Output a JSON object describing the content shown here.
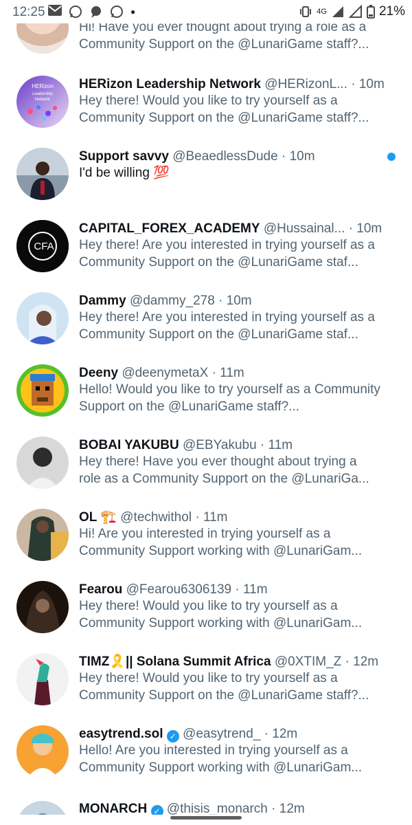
{
  "status_bar": {
    "time": "12:25",
    "network": "4G",
    "battery": "21%",
    "icons": [
      "gmail-icon",
      "whatsapp-icon",
      "chat-icon",
      "whatsapp-icon",
      "dot-icon",
      "vibrate-icon",
      "signal-icon",
      "signal-icon",
      "battery-icon"
    ]
  },
  "conversations": [
    {
      "name": "",
      "handle": "",
      "time": "",
      "preview": "Hi! Have you ever thought about trying a role as a Community Support on the @LunariGame staff?...",
      "unread": false
    },
    {
      "name": "HERizon Leadership Network",
      "handle": "@HERizonL...",
      "time": "10m",
      "preview": "Hey there! Would you like to try yourself as a Community Support on the @LunariGame staff?...",
      "unread": false
    },
    {
      "name": "Support savvy",
      "handle": "@BeaedlessDude",
      "time": "10m",
      "preview": "I'd be willing 💯",
      "unread": true
    },
    {
      "name": "CAPITAL_FOREX_ACADEMY",
      "handle": "@Hussainal...",
      "time": "10m",
      "preview": "Hey there! Are you interested in trying yourself as a Community Support on the @LunariGame staf...",
      "unread": false
    },
    {
      "name": "Dammy",
      "handle": "@dammy_278",
      "time": "10m",
      "preview": "Hey there! Are you interested in trying yourself as a Community Support on the @LunariGame staf...",
      "unread": false
    },
    {
      "name": "Deeny",
      "handle": "@deenymetaX",
      "time": "11m",
      "preview": "Hello! Would you like to try yourself as a Community Support on the @LunariGame staff?...",
      "unread": false
    },
    {
      "name": "BOBAI YAKUBU",
      "handle": "@EBYakubu",
      "time": "11m",
      "preview": "Hey there! Have you ever thought about trying a role as a Community Support on the @LunariGa...",
      "unread": false
    },
    {
      "name": "OL 🏗️",
      "handle": "@techwithol",
      "time": "11m",
      "preview": "Hi! Are you interested in trying yourself as a Community Support working with @LunariGam...",
      "unread": false
    },
    {
      "name": "Fearou",
      "handle": "@Fearou6306139",
      "time": "11m",
      "preview": "Hey there! Would you like to try yourself as a Community Support working with @LunariGam...",
      "unread": false
    },
    {
      "name": "TIMZ🎗️|| Solana Summit Africa",
      "handle": "@0XTIM_Z",
      "time": "12m",
      "preview": "Hey there! Would you like to try yourself as a Community Support on the @LunariGame staff?...",
      "unread": false
    },
    {
      "name": "easytrend.sol",
      "handle": "@easytrend_",
      "time": "12m",
      "preview": "Hello! Are you interested in trying yourself as a Community Support working with @LunariGam...",
      "unread": false,
      "verified": true
    },
    {
      "name": "MONARCH",
      "handle": "@thisis_monarch",
      "time": "12m",
      "preview": "",
      "unread": false,
      "verified": true
    }
  ],
  "avatar_text": {
    "herizon": "HERizon Leadership Network",
    "cfa": "CFA"
  }
}
